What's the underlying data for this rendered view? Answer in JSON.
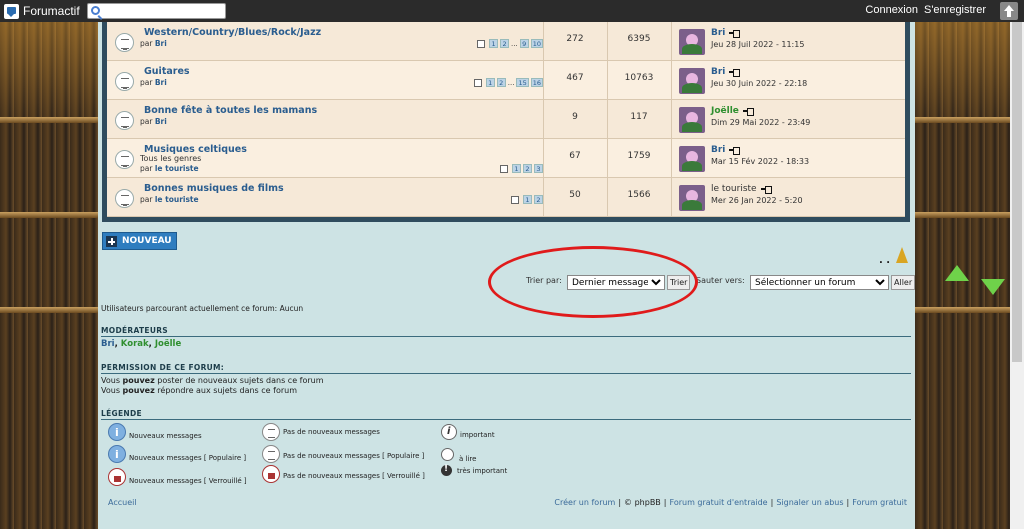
{
  "topbar": {
    "brand": "Forumactif",
    "search_placeholder": "",
    "login": "Connexion",
    "register": "S'enregistrer"
  },
  "forums": [
    {
      "title": "Western/Country/Blues/Rock/Jazz",
      "desc": "",
      "by_label": "par",
      "by_user": "Bri",
      "pages": [
        "1",
        "2",
        "...",
        "9",
        "10"
      ],
      "topics": "272",
      "posts": "6395",
      "last_user": "Bri",
      "last_user_color": "blue",
      "last_date": "Jeu 28 Juil 2022 - 11:15"
    },
    {
      "title": "Guitares",
      "desc": "",
      "by_label": "par",
      "by_user": "Bri",
      "pages": [
        "1",
        "2",
        "...",
        "15",
        "16"
      ],
      "topics": "467",
      "posts": "10763",
      "last_user": "Bri",
      "last_user_color": "blue",
      "last_date": "Jeu 30 Juin 2022 - 22:18"
    },
    {
      "title": "Bonne fête à toutes les mamans",
      "desc": "",
      "by_label": "par",
      "by_user": "Bri",
      "pages": [],
      "topics": "9",
      "posts": "117",
      "last_user": "Joëlle",
      "last_user_color": "green",
      "last_date": "Dim 29 Mai 2022 - 23:49"
    },
    {
      "title": "Musiques celtiques",
      "desc": "Tous les genres",
      "by_label": "par",
      "by_user": "le touriste",
      "pages": [
        "1",
        "2",
        "3"
      ],
      "topics": "67",
      "posts": "1759",
      "last_user": "Bri",
      "last_user_color": "blue",
      "last_date": "Mar 15 Fév 2022 - 18:33"
    },
    {
      "title": "Bonnes musiques de films",
      "desc": "",
      "by_label": "par",
      "by_user": "le touriste",
      "pages": [
        "1",
        "2"
      ],
      "topics": "50",
      "posts": "1566",
      "last_user": "le touriste",
      "last_user_color": "plain",
      "last_date": "Mer 26 Jan 2022 - 5:20"
    }
  ],
  "new_topic_label": "NOUVEAU",
  "sort": {
    "label": "Trier par:",
    "selected": "Dernier message",
    "button": "Trier"
  },
  "jump": {
    "label": "Sauter vers:",
    "selected": "Sélectionner un forum",
    "button": "Aller"
  },
  "browsing": "Utilisateurs parcourant actuellement ce forum: Aucun",
  "moderators": {
    "title": "MODÉRATEURS",
    "list": [
      "Bri",
      "Korak",
      "Joëlle"
    ]
  },
  "permissions": {
    "title": "PERMISSION DE CE FORUM:",
    "line1_a": "Vous ",
    "line1_b": "pouvez",
    "line1_c": " poster de nouveaux sujets dans ce forum",
    "line2_a": "Vous ",
    "line2_b": "pouvez",
    "line2_c": " répondre aux sujets dans ce forum"
  },
  "legend": {
    "title": "LÉGENDE",
    "items": [
      "Nouveaux messages",
      "Nouveaux messages [ Populaire ]",
      "Nouveaux messages [ Verrouillé ]",
      "Pas de nouveaux messages",
      "Pas de nouveaux messages [ Populaire ]",
      "Pas de nouveaux messages [ Verrouillé ]",
      "important",
      "à lire",
      "très important"
    ]
  },
  "footer": {
    "home": "Accueil",
    "create": "Créer un forum",
    "copy": "© phpBB",
    "free": "Forum gratuit d'entraide",
    "report": "Signaler un abus",
    "freeforum": "Forum gratuit"
  },
  "colors": {
    "link_blue": "#2a5d8f",
    "mod_green": "#2f8f2f",
    "button_blue": "#2e7dbf",
    "highlight_red": "#e01b1b"
  }
}
